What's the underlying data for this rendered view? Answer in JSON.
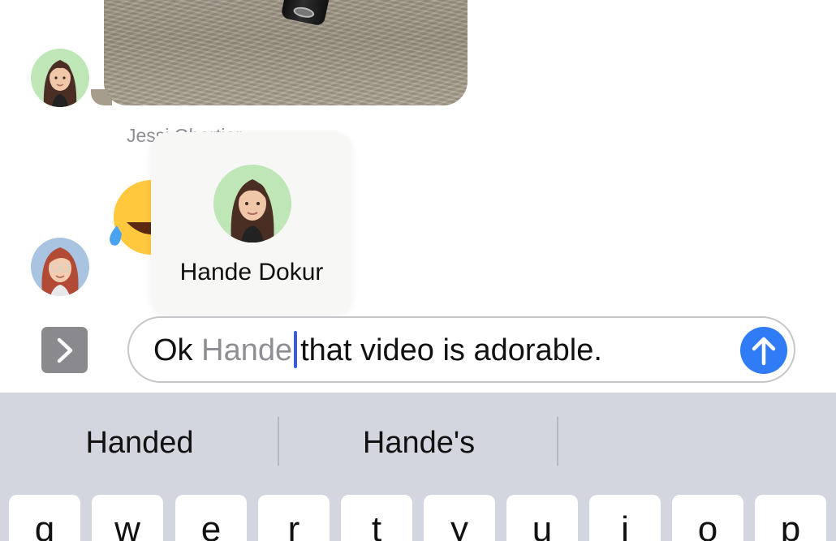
{
  "conversation": {
    "sender_name": "Jessi Ghartier"
  },
  "mention_suggestion": {
    "name": "Hande Dokur"
  },
  "composer": {
    "text_before": "Ok ",
    "mention": "Hande",
    "text_after": "that video is adorable."
  },
  "predictive_bar": {
    "suggestions": [
      "Handed",
      "Hande's",
      ""
    ]
  },
  "keyboard": {
    "keys": [
      "q",
      "w",
      "e",
      "r",
      "t",
      "y",
      "u",
      "i",
      "o",
      "p"
    ]
  },
  "colors": {
    "accent_blue": "#2f7cf6",
    "caret": "#3d5bd9",
    "keyboard_bg": "#d3d6de"
  }
}
